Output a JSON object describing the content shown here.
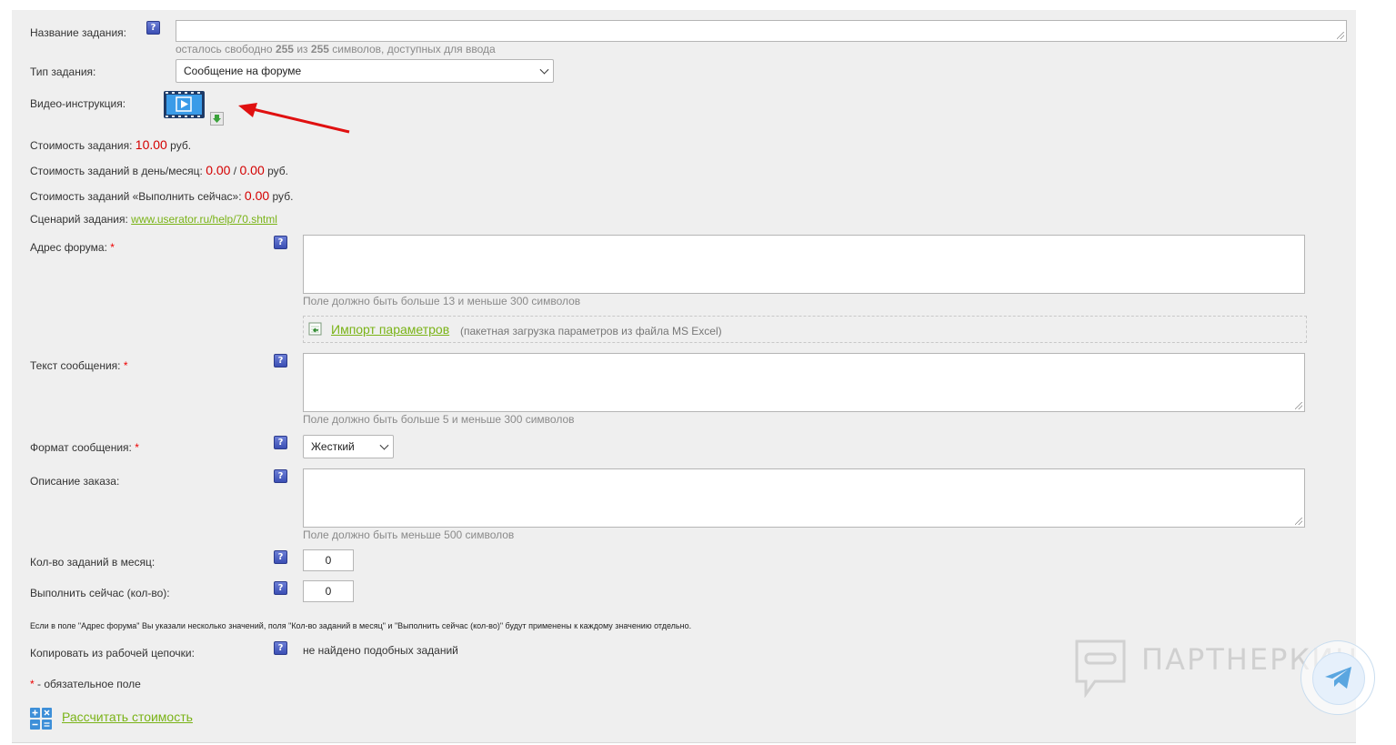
{
  "form": {
    "task_name": {
      "label": "Название задания:",
      "value": "",
      "hint_prefix": "осталось свободно",
      "hint_count": "255",
      "hint_mid": "из",
      "hint_total": "255",
      "hint_suffix": "символов, доступных для ввода"
    },
    "task_type": {
      "label": "Тип задания:",
      "value": "Сообщение на форуме"
    },
    "video": {
      "label": "Видео-инструкция:"
    },
    "cost": {
      "label": "Стоимость задания:",
      "value": "10.00",
      "unit": "руб."
    },
    "cost_day_month": {
      "label": "Стоимость заданий в день/месяц:",
      "day": "0.00",
      "sep": "/",
      "month": "0.00",
      "unit": "руб."
    },
    "cost_now": {
      "label": "Стоимость заданий «Выполнить сейчас»:",
      "value": "0.00",
      "unit": "руб."
    },
    "scenario": {
      "label": "Сценарий задания:",
      "link": "www.userator.ru/help/70.shtml"
    },
    "forum_address": {
      "label": "Адрес форума:",
      "required": "*",
      "value": "",
      "hint": "Поле должно быть больше 13 и меньше 300 символов"
    },
    "import": {
      "link": "Импорт параметров",
      "note": "(пакетная загрузка параметров из файла MS Excel)"
    },
    "message_text": {
      "label": "Текст сообщения:",
      "required": "*",
      "value": "",
      "hint": "Поле должно быть больше 5 и меньше 300 символов"
    },
    "message_format": {
      "label": "Формат сообщения:",
      "required": "*",
      "value": "Жесткий"
    },
    "order_description": {
      "label": "Описание заказа:",
      "value": "",
      "hint": "Поле должно быть меньше 500 символов"
    },
    "tasks_per_month": {
      "label": "Кол-во заданий в месяц:",
      "value": "0"
    },
    "execute_now": {
      "label": "Выполнить сейчас (кол-во):",
      "value": "0"
    },
    "note": "Если в поле \"Адрес форума\" Вы указали несколько значений, поля \"Кол-во заданий в месяц\" и \"Выполнить сейчас (кол-во)\" будут применены к каждому значению отдельно.",
    "copy_chain": {
      "label": "Копировать из рабочей цепочки:",
      "value": "не найдено подобных заданий"
    },
    "required_note": {
      "star": "*",
      "text": "- обязательное поле"
    },
    "calculate": {
      "label": "Рассчитать стоимость"
    },
    "help_glyph": "?"
  },
  "watermark": {
    "text": "ПАРТНЕРКИН"
  },
  "colors": {
    "price": "#d40000",
    "link": "#7ab317",
    "required": "#e00000",
    "panel": "#efefef",
    "arrow": "#e01010"
  }
}
